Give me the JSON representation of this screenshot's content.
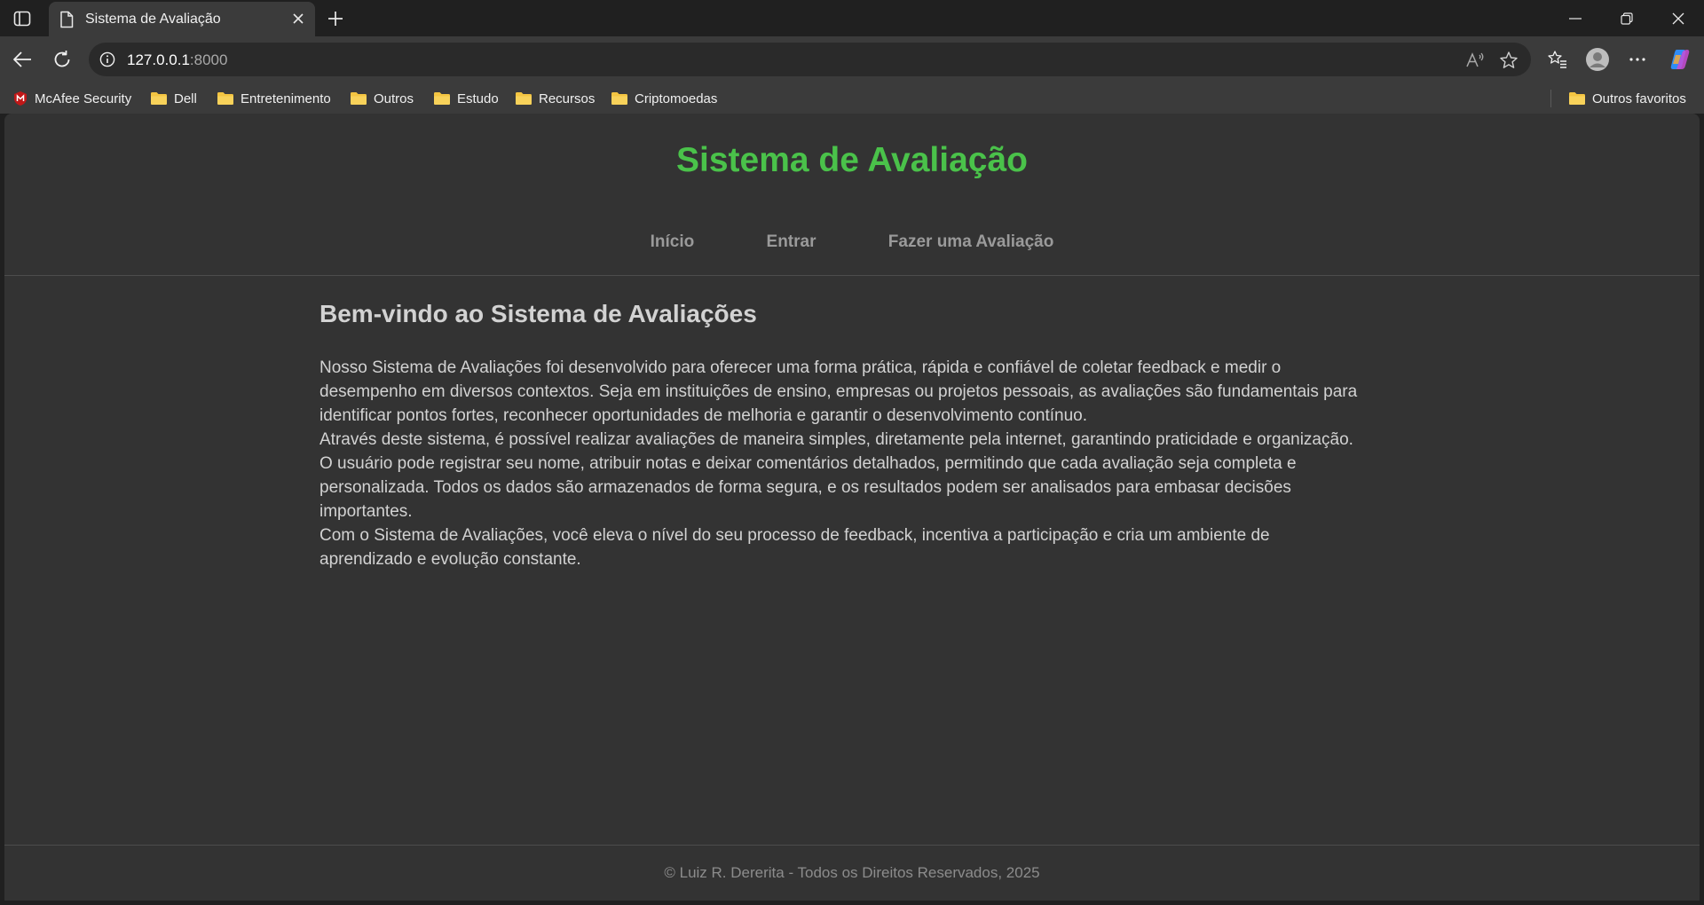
{
  "browser": {
    "tab": {
      "title": "Sistema de Avaliação"
    },
    "address": {
      "host": "127.0.0.1",
      "port": ":8000"
    },
    "bookmarks": [
      {
        "label": "McAfee Security",
        "icon": "mcafee-icon"
      },
      {
        "label": "Dell",
        "icon": "folder-icon"
      },
      {
        "label": "Entretenimento",
        "icon": "folder-icon"
      },
      {
        "label": "Outros",
        "icon": "folder-icon"
      },
      {
        "label": "Estudo",
        "icon": "folder-icon"
      },
      {
        "label": "Recursos",
        "icon": "folder-icon"
      },
      {
        "label": "Criptomoedas",
        "icon": "folder-icon"
      }
    ],
    "other_bookmarks": "Outros favoritos",
    "colors": {
      "chrome": "#202020",
      "toolbar": "#3b3b3b",
      "page": "#333333",
      "accent": "#4ac24a"
    }
  },
  "page": {
    "title": "Sistema de Avaliação",
    "nav": [
      {
        "label": "Início"
      },
      {
        "label": "Entrar"
      },
      {
        "label": "Fazer uma Avaliação"
      }
    ],
    "heading": "Bem-vindo ao Sistema de Avaliações",
    "paragraphs": [
      "Nosso Sistema de Avaliações foi desenvolvido para oferecer uma forma prática, rápida e confiável de coletar feedback e medir o desempenho em diversos contextos. Seja em instituições de ensino, empresas ou projetos pessoais, as avaliações são fundamentais para identificar pontos fortes, reconhecer oportunidades de melhoria e garantir o desenvolvimento contínuo.",
      "Através deste sistema, é possível realizar avaliações de maneira simples, diretamente pela internet, garantindo praticidade e organização. O usuário pode registrar seu nome, atribuir notas e deixar comentários detalhados, permitindo que cada avaliação seja completa e personalizada. Todos os dados são armazenados de forma segura, e os resultados podem ser analisados para embasar decisões importantes.",
      "Com o Sistema de Avaliações, você eleva o nível do seu processo de feedback, incentiva a participação e cria um ambiente de aprendizado e evolução constante."
    ],
    "footer": "© Luiz R. Dererita - Todos os Direitos Reservados, 2025"
  }
}
